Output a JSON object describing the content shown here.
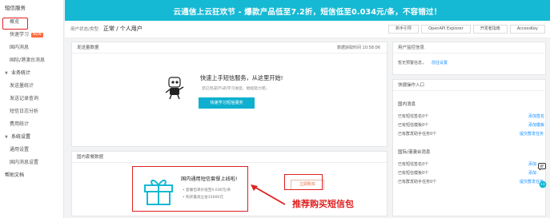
{
  "sidebar": {
    "title": "短信服务",
    "items": [
      {
        "label": "概览"
      },
      {
        "label": "快速学习",
        "badge": "NEW"
      },
      {
        "label": "国内消息"
      },
      {
        "label": "国际/港澳台消息"
      },
      {
        "label": "业务统计",
        "group": true
      },
      {
        "label": "发送量统计"
      },
      {
        "label": "发送记录查询"
      },
      {
        "label": "短信日志分析"
      },
      {
        "label": "费用统计"
      },
      {
        "label": "系统设置",
        "group": true
      },
      {
        "label": "通用设置"
      },
      {
        "label": "国内消息设置"
      },
      {
        "label": "帮助文档"
      }
    ]
  },
  "banner": {
    "text": "云通信上云狂欢节 - 爆款产品低至7.2折，短信低至0.034元/条，不容错过！"
  },
  "header": {
    "status_label": "用户状态/类型:",
    "status_value": "正常 / 个人用户",
    "links": [
      "新手引导",
      "OpenAPI Explorer",
      "开发者指南",
      "AccessKey"
    ]
  },
  "send_panel": {
    "title": "发送量数据",
    "time": "数据获取时间 10:58:06",
    "qs_title": "快速上手短信服务，从这里开始!",
    "qs_sub": "您已完成0%的学习进度，继续努力吧。",
    "qs_button": "快速学习短信服务"
  },
  "package_panel": {
    "title": "国内套餐数据",
    "gift_title": "国内通用短信套餐上线啦!",
    "bullet1": "• 套餐包单价低至0.036元/条",
    "bullet2": "• 购买最高立省33000元",
    "buy_button": "立即购买",
    "annotation": "推荐购买短信包"
  },
  "monitor_panel": {
    "title": "用户监控信息",
    "row": "暂无预警信息，",
    "link": "前往设置"
  },
  "quick_panel": {
    "title": "快捷操作入口",
    "domestic": {
      "heading": "国内消息",
      "rows": [
        {
          "text": "已有短信签名0个",
          "link": "添加签名"
        },
        {
          "text": "已有短信模板0个",
          "link": "添加模板"
        },
        {
          "text": "已有群发助手任务0个",
          "link": "提交群发任务"
        }
      ]
    },
    "intl": {
      "heading": "国际/港澳台消息",
      "rows": [
        {
          "text": "已有短信签名0个",
          "link": "添加"
        },
        {
          "text": "已有短信模板0个",
          "link": "添加"
        },
        {
          "text": "已有群发助手任务0个",
          "link": "提交群发任务"
        }
      ]
    }
  },
  "colors": {
    "accent": "#16b9d4",
    "annotation": "#e02020",
    "link": "#1890ff"
  }
}
